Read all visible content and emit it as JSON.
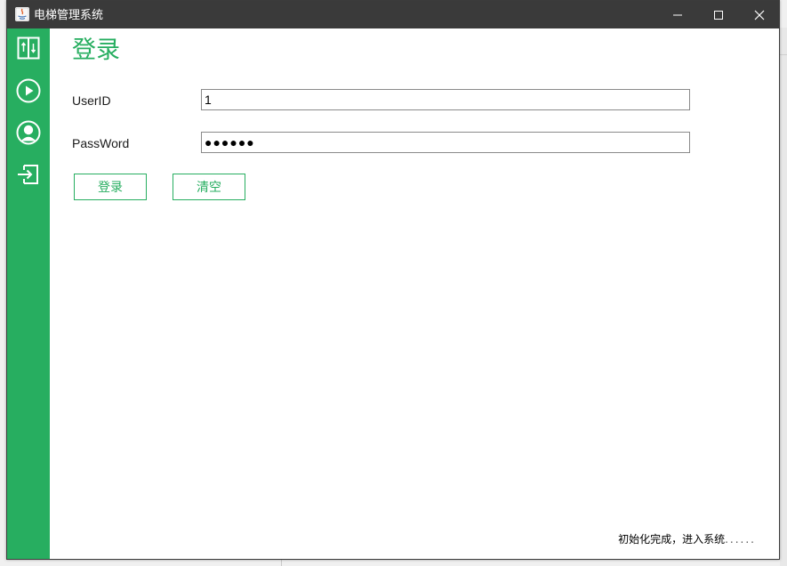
{
  "window": {
    "title": "电梯管理系统",
    "controls": {
      "minimize_icon": "minimize-icon",
      "maximize_icon": "maximize-icon",
      "close_icon": "close-icon"
    }
  },
  "sidebar": {
    "items": [
      {
        "name": "elevator",
        "icon": "elevator-icon"
      },
      {
        "name": "run",
        "icon": "play-circle-icon"
      },
      {
        "name": "user",
        "icon": "user-circle-icon"
      },
      {
        "name": "login",
        "icon": "login-icon"
      }
    ]
  },
  "login": {
    "title": "登录",
    "userid_label": "UserID",
    "userid_value": "1",
    "password_label": "PassWord",
    "password_value": "●●●●●●",
    "login_button": "登录",
    "clear_button": "清空"
  },
  "status": {
    "text": "初始化完成，进入系统",
    "dots": "......"
  },
  "colors": {
    "accent": "#27ae60",
    "titlebar": "#3a3a3a"
  }
}
